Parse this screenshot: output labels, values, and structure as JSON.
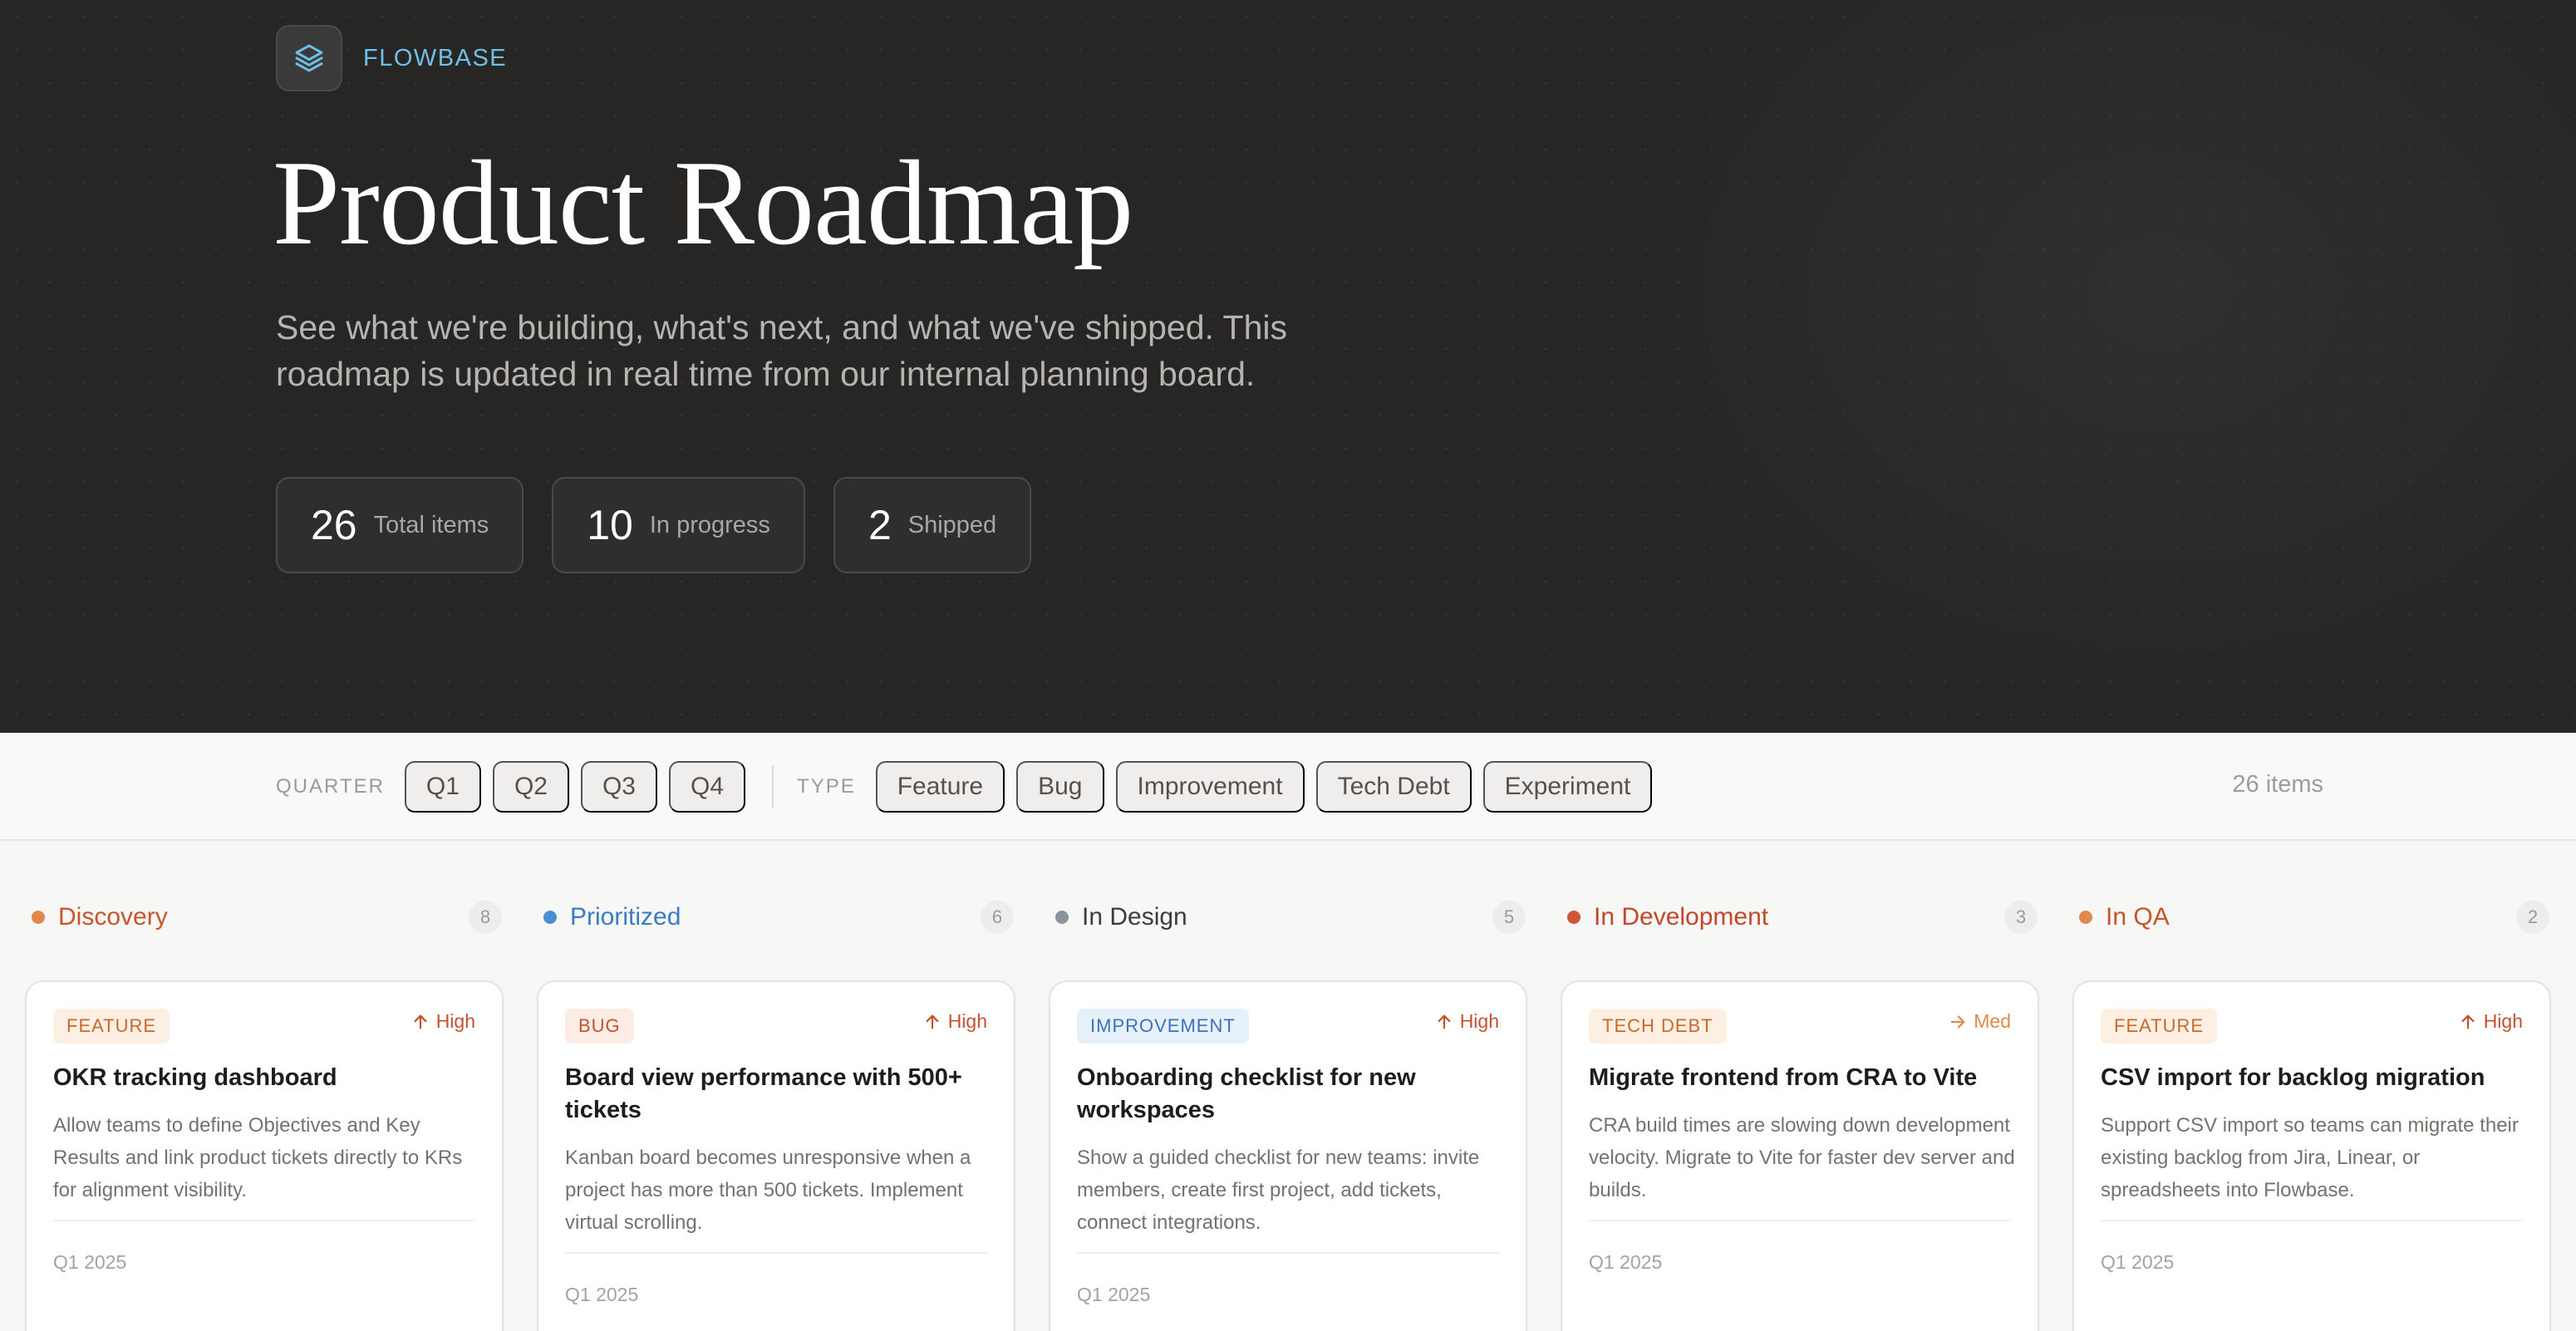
{
  "brand": {
    "name": "FLOWBASE",
    "logo_icon": "layers-icon"
  },
  "hero": {
    "title": "Product Roadmap",
    "description": "See what we're building, what's next, and what we've shipped. This roadmap is updated in real time from our internal planning board."
  },
  "stats": [
    {
      "value": "26",
      "label": "Total items"
    },
    {
      "value": "10",
      "label": "In progress"
    },
    {
      "value": "2",
      "label": "Shipped"
    }
  ],
  "filters": {
    "quarter_label": "QUARTER",
    "quarters": [
      "Q1",
      "Q2",
      "Q3",
      "Q4"
    ],
    "type_label": "TYPE",
    "types": [
      "Feature",
      "Bug",
      "Improvement",
      "Tech Debt",
      "Experiment"
    ],
    "items_count": "26 items"
  },
  "colors": {
    "hero_bg": "#272625",
    "brand_accent": "#6fc0e6",
    "high_priority": "#c4522f",
    "med_priority": "#e08a4c"
  },
  "columns": [
    {
      "title": "Discovery",
      "count": "8",
      "dot_color": "#e0874a",
      "title_color": "#c9532a",
      "card": {
        "tag": "FEATURE",
        "tag_bg": "#fdf0e2",
        "tag_color": "#c9682a",
        "priority": "High",
        "priority_icon": "arrow-up-icon",
        "priority_color": "#c4522f",
        "title_lines": [
          "OKR tracking dashboard"
        ],
        "description": "Allow teams to define Objectives and Key Results and link product tickets directly to KRs for alignment visibility.",
        "date": "Q1 2025"
      }
    },
    {
      "title": "Prioritized",
      "count": "6",
      "dot_color": "#4a8fd6",
      "title_color": "#3b7bc4",
      "card": {
        "tag": "BUG",
        "tag_bg": "#fdece6",
        "tag_color": "#c4522f",
        "priority": "High",
        "priority_icon": "arrow-up-icon",
        "priority_color": "#c4522f",
        "title_lines": [
          "Board view performance with 500+",
          "tickets"
        ],
        "description": "Kanban board becomes unresponsive when a project has more than 500 tickets. Implement virtual scrolling.",
        "date": "Q1 2025"
      }
    },
    {
      "title": "In Design",
      "count": "5",
      "dot_color": "#8a9399",
      "title_color": "#3f3d3b",
      "card": {
        "tag": "IMPROVEMENT",
        "tag_bg": "#e6f0fb",
        "tag_color": "#3b72b8",
        "priority": "High",
        "priority_icon": "arrow-up-icon",
        "priority_color": "#c4522f",
        "title_lines": [
          "Onboarding checklist for new",
          "workspaces"
        ],
        "description": "Show a guided checklist for new teams: invite members, create first project, add tickets, connect integrations.",
        "date": "Q1 2025"
      }
    },
    {
      "title": "In Development",
      "count": "3",
      "dot_color": "#d0533a",
      "title_color": "#c4472a",
      "card": {
        "tag": "TECH DEBT",
        "tag_bg": "#fdf0e2",
        "tag_color": "#c9682a",
        "priority": "Med",
        "priority_icon": "arrow-right-icon",
        "priority_color": "#e08a4c",
        "title_lines": [
          "Migrate frontend from CRA to Vite"
        ],
        "description": "CRA build times are slowing down development velocity. Migrate to Vite for faster dev server and builds.",
        "date": "Q1 2025"
      }
    },
    {
      "title": "In QA",
      "count": "2",
      "dot_color": "#e08a4c",
      "title_color": "#c9532a",
      "card": {
        "tag": "FEATURE",
        "tag_bg": "#fdf0e2",
        "tag_color": "#c9682a",
        "priority": "High",
        "priority_icon": "arrow-up-icon",
        "priority_color": "#c4522f",
        "title_lines": [
          "CSV import for backlog migration"
        ],
        "description": "Support CSV import so teams can migrate their existing backlog from Jira, Linear, or spreadsheets into Flowbase.",
        "date": "Q1 2025"
      }
    }
  ]
}
